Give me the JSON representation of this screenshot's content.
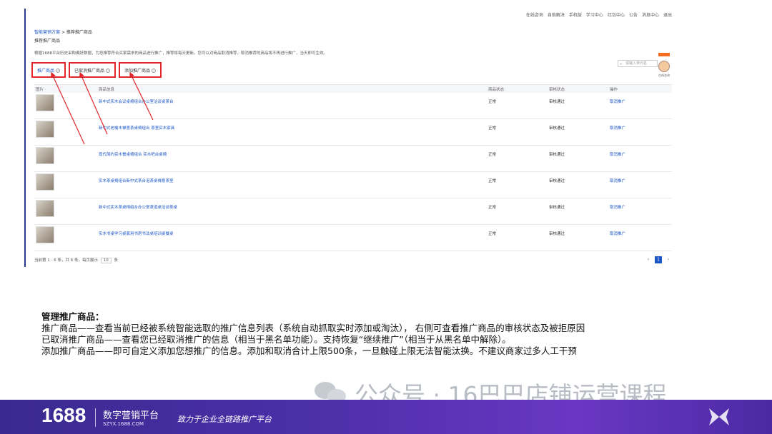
{
  "topbar": [
    "在线咨询",
    "自助解决",
    "手机版",
    "学习中心",
    "红包中心",
    "公告",
    "消息中心",
    "退出"
  ],
  "breadcrumb": {
    "root": "智能营销方案",
    "sep": ">",
    "current": "推荐推广商品"
  },
  "subtitle": "推荐推广商品",
  "notice": "根据1688平台历史采购偏好数据，为您推荐符合买家需求的商品进行推广，推荐将每天更新。您可以对商品取消推荐，取消推荐的商品将不再进行推广，当天即可生效。",
  "tabs": [
    {
      "label": "推广商品"
    },
    {
      "label": "已取消推广商品"
    },
    {
      "label": "添加推广商品"
    }
  ],
  "search": {
    "placeholder": "请输入单元名"
  },
  "mascot": {
    "label": "在线咨询"
  },
  "table": {
    "headers": [
      "图片",
      "商品信息",
      "商品状态",
      "审核状态",
      "操作"
    ],
    "rows": [
      {
        "title": "新中式实木会议桌椅组合办公室洽谈桌茶台",
        "status": "正常",
        "review": "审核通过",
        "op": "取消推广"
      },
      {
        "title": "新中式老榆木禅意茶桌椅组合 茶室实木家具",
        "status": "正常",
        "review": "审核通过",
        "op": "取消推广"
      },
      {
        "title": "现代简约实木餐桌椅组合 实木吧台桌椅",
        "status": "正常",
        "review": "审核通过",
        "op": "取消推广"
      },
      {
        "title": "实木茶桌椅组合新中式茶台泡茶桌禅意茶室",
        "status": "正常",
        "review": "审核通过",
        "op": "取消推广"
      },
      {
        "title": "新中式实木茶桌椅组合办公室茶道桌洽谈茶桌",
        "status": "正常",
        "review": "审核通过",
        "op": "取消推广"
      },
      {
        "title": "实木书桌学习桌家用书房书法桌培训桌餐桌",
        "status": "正常",
        "review": "审核通过",
        "op": "取消推广"
      }
    ]
  },
  "pagination": {
    "summary": "当前第 1 - 6 条，共 6 条，每页展示",
    "per_page": "10",
    "unit": "条",
    "prev": "‹",
    "page": "1",
    "next": "›"
  },
  "description": {
    "heading": "管理推广商品：",
    "lines": [
      "推广商品——查看当前已经被系统智能选取的推广信息列表（系统自动抓取实时添加或淘汰）， 右侧可查看推广商品的审核状态及被拒原因",
      "已取消推广商品——查看您已经取消推广的信息（相当于黑名单功能）。支持恢复“继续推广”（相当于从黑名单中解除）。",
      "添加推广商品——即可自定义添加您想推广的信息。添加和取消合计上限500条，一旦触碰上限无法智能汰换。不建议商家过多人工干预"
    ]
  },
  "watermark": "公众号 · 16巴巴店铺运营课程",
  "footer": {
    "brand": "1688",
    "platform": "数字营销平台",
    "url": "SZYX.1688.COM",
    "slogan": "致力于企业全链路推广平台"
  },
  "colors": {
    "accent": "#1a56c6",
    "annotation": "#e0262b",
    "band": "#4b2fa8"
  }
}
